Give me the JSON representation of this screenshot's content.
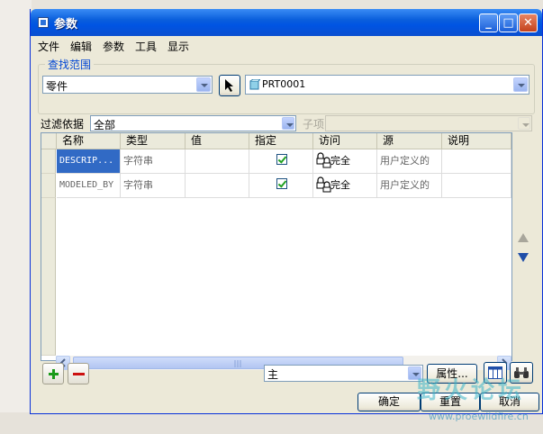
{
  "window": {
    "title": "参数"
  },
  "menu": [
    "文件",
    "编辑",
    "参数",
    "工具",
    "显示"
  ],
  "lookup": {
    "group_label": "查找范围",
    "scope_value": "零件",
    "model_value": "PRT0001"
  },
  "filter": {
    "label": "过滤依据",
    "value": "全部",
    "child_label": "子项",
    "child_value": ""
  },
  "table": {
    "columns": [
      "名称",
      "类型",
      "值",
      "指定",
      "访问",
      "源",
      "说明"
    ],
    "rows": [
      {
        "name": "DESCRIP...",
        "type": "字符串",
        "value": "",
        "designated": true,
        "access": "完全",
        "source": "用户定义的",
        "description": "",
        "selected": true
      },
      {
        "name": "MODELED_BY",
        "type": "字符串",
        "value": "",
        "designated": true,
        "access": "完全",
        "source": "用户定义的",
        "description": "",
        "selected": false
      }
    ]
  },
  "bottom": {
    "main_select_value": "主",
    "properties_label": "属性...",
    "ok_label": "确定",
    "reset_label": "重置",
    "cancel_label": "取消"
  },
  "watermark": {
    "text": "野火论坛",
    "url": "www.proewildfire.cn"
  },
  "colors": {
    "titlebar": "#0054e3",
    "selection": "#316ac5",
    "group_label": "#0046d5"
  }
}
